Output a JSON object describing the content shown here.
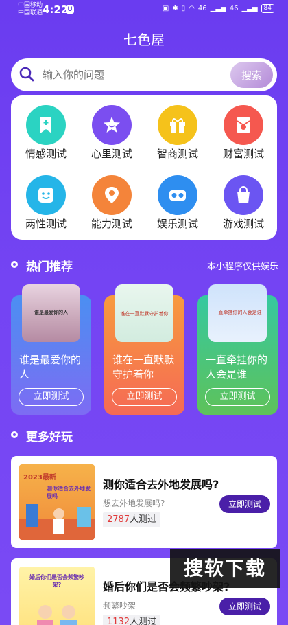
{
  "status": {
    "carrier1": "中国移动",
    "carrier2": "中国联通",
    "time": "4:22",
    "badge": "U",
    "signal": "46",
    "battery": "84"
  },
  "app": {
    "title": "七色屋"
  },
  "search": {
    "placeholder": "输入你的问题",
    "button": "搜索"
  },
  "categories": [
    {
      "label": "情感测试",
      "icon": "bookmark-icon",
      "color": "#2bd3c2"
    },
    {
      "label": "心里测试",
      "icon": "star-icon",
      "color": "#7b4ef0"
    },
    {
      "label": "智商测试",
      "icon": "gift-icon",
      "color": "#f5c21b"
    },
    {
      "label": "财富测试",
      "icon": "red-envelope-icon",
      "color": "#f5584f"
    },
    {
      "label": "两性测试",
      "icon": "smile-face-icon",
      "color": "#25b5e8"
    },
    {
      "label": "能力测试",
      "icon": "location-pin-icon",
      "color": "#f4843a"
    },
    {
      "label": "娱乐测试",
      "icon": "vr-glasses-icon",
      "color": "#2e8ef0"
    },
    {
      "label": "游戏测试",
      "icon": "shopping-bag-icon",
      "color": "#6b55f2"
    }
  ],
  "hot": {
    "title": "热门推荐",
    "note": "本小程序仅供娱乐",
    "items": [
      {
        "title": "谁是最爱你的人",
        "button": "立即测试",
        "img_text": "谁是最爱你的人"
      },
      {
        "title": "谁在一直默默守护着你",
        "button": "立即测试",
        "img_text": "谁在一直默默守护着你"
      },
      {
        "title": "一直牵挂你的人会是谁",
        "button": "立即测试",
        "img_text": "一直牵挂你的人会是谁"
      }
    ]
  },
  "more": {
    "title": "更多好玩",
    "items": [
      {
        "title": "测你适合去外地发展吗?",
        "subtitle": "想去外地发展吗?",
        "count": "2787",
        "count_suffix": "人测过",
        "button": "立即测试",
        "thumb_text1": "2023最新",
        "thumb_text2": "测你适合去外地发展吗"
      },
      {
        "title": "婚后你们是否会频繁吵架?",
        "subtitle": "频繁吵架",
        "count": "1132",
        "count_suffix": "人测过",
        "button": "立即测试",
        "thumb_text1": "婚后你们是否会频繁吵架?"
      }
    ]
  },
  "watermark": "搜软下载"
}
